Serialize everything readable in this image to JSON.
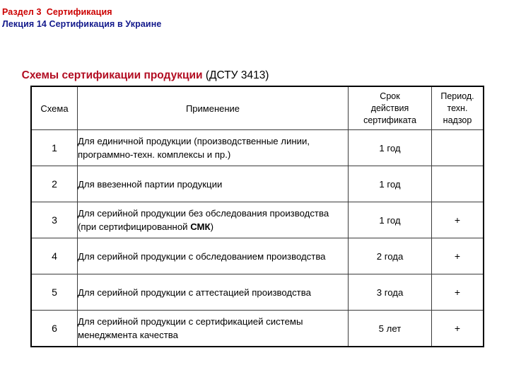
{
  "header": {
    "line1": "Раздел 3  Сертификация",
    "line2": "Лекция 14 Сертификация в Украине",
    "color_line1": "#cc0000",
    "color_line2": "#131a8c"
  },
  "title": {
    "main": "Схемы сертификации продукции",
    "sub": " (ДСТУ 3413)",
    "color_main": "#b20d22",
    "color_sub": "#000000"
  },
  "table": {
    "columns": [
      {
        "key": "scheme",
        "label": "Схема"
      },
      {
        "key": "application",
        "label": "Применение"
      },
      {
        "key": "term",
        "label": "Срок\nдействия\nсертификата"
      },
      {
        "key": "supervision",
        "label": "Период.\nтехн.\nнадзор"
      }
    ],
    "rows": [
      {
        "scheme": "1",
        "application_pre": "Для единичной продукции (производственные линии, программно-техн. комплексы и пр.)",
        "application_bold": "",
        "application_post": "",
        "term": "1 год",
        "supervision": ""
      },
      {
        "scheme": "2",
        "application_pre": "Для ввезенной партии продукции",
        "application_bold": "",
        "application_post": "",
        "term": "1 год",
        "supervision": ""
      },
      {
        "scheme": "3",
        "application_pre": "Для серийной продукции без обследования производства (при сертифицированной ",
        "application_bold": "СМК",
        "application_post": ")",
        "term": "1 год",
        "supervision": "+"
      },
      {
        "scheme": "4",
        "application_pre": "Для серийной продукции с обследованием производства",
        "application_bold": "",
        "application_post": "",
        "term": "2 года",
        "supervision": "+"
      },
      {
        "scheme": "5",
        "application_pre": "Для серийной продукции с аттестацией производства",
        "application_bold": "",
        "application_post": "",
        "term": "3 года",
        "supervision": "+"
      },
      {
        "scheme": "6",
        "application_pre": "Для серийной продукции с сертификацией системы менеджмента качества",
        "application_bold": "",
        "application_post": "",
        "term": "5 лет",
        "supervision": "+"
      }
    ]
  }
}
